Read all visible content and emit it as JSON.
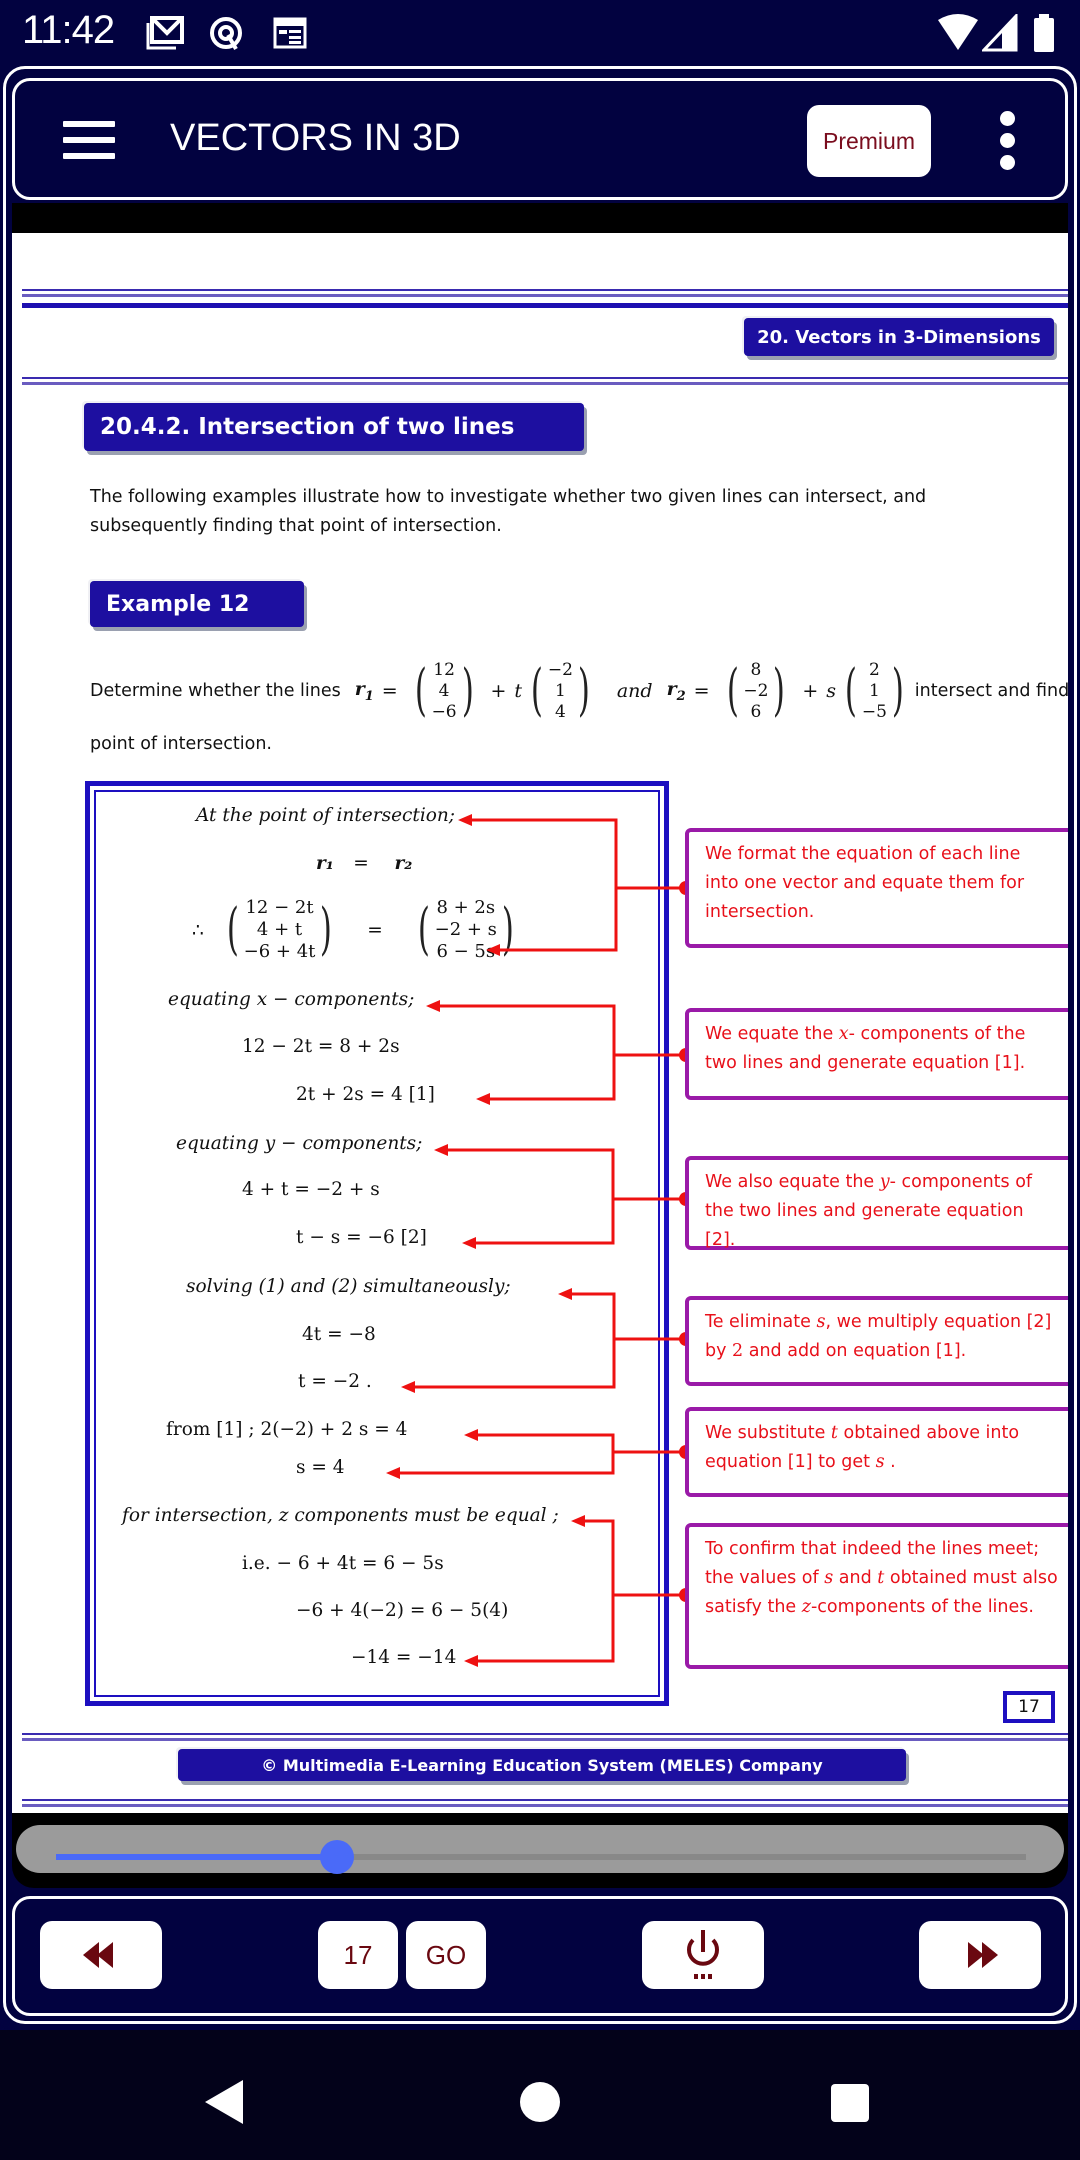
{
  "status_bar": {
    "time": "11:42",
    "left_icons": [
      "gmail-icon",
      "app-q-icon",
      "calendar-icon"
    ],
    "right_icons": [
      "wifi-icon",
      "signal-icon",
      "battery-icon"
    ]
  },
  "app_bar": {
    "title": "VECTORS IN 3D",
    "premium_label": "Premium",
    "menu_icon": "hamburger-menu-icon",
    "overflow_icon": "kebab-menu-icon"
  },
  "document": {
    "chapter_label": "20. Vectors in 3-Dimensions",
    "section_title": "20.4.2. Intersection of two lines",
    "intro": "The following examples illustrate how to investigate whether two given lines can intersect, and subsequently finding that point of intersection.",
    "example_label": "Example 12",
    "question": {
      "lead": "Determine whether the lines",
      "r1_label": "r",
      "r1_sub": "1",
      "eq": "=",
      "r1_point": [
        "12",
        "4",
        "−6"
      ],
      "plus": "+",
      "t": "t",
      "r1_dir": [
        "−2",
        "1",
        "4"
      ],
      "and": "and",
      "r2_label": "r",
      "r2_sub": "2",
      "r2_point": [
        "8",
        "−2",
        "6"
      ],
      "s": "s",
      "r2_dir": [
        "2",
        "1",
        "−5"
      ],
      "tail": "intersect and find this",
      "tail2": "point of intersection."
    },
    "solution": {
      "l1": "At the point of intersection;",
      "l2_left": "r₁",
      "l2_eq": "=",
      "l2_right": "r₂",
      "therefore": "∴",
      "lhs_vec": [
        "12 − 2t",
        "4 + t",
        "−6 + 4t"
      ],
      "rhs_vec": [
        "8 + 2s",
        "−2 + s",
        "6 − 5s"
      ],
      "l3_eq": "=",
      "x_head": "equating  x − components;",
      "x_eq1": "12 − 2t    =   8 +  2s",
      "x_eq2": "2t + 2s  =  4      [1]",
      "y_head": "equating  y − components;",
      "y_eq1": "4 + t    = −2 +  s",
      "y_eq2": "t − s  =  −6      [2]",
      "solve_head": "solving  (1)  and   (2)  simultaneously;",
      "solve_eq1": "4t  =  −8",
      "solve_eq2": "t     =  −2 .",
      "from1": "from  [1] ;    2(−2) + 2 s     =   4",
      "s_val": "s    =    4",
      "z_head": "for intersection,  z  components must be equal ;",
      "z_eq1": "i.e.    − 6 + 4t    =    6 − 5s",
      "z_eq2": "−6 + 4(−2) = 6 − 5(4)",
      "z_eq3": "−14  =  −14"
    },
    "notes": [
      {
        "text": "We format the equation of each line into one vector and equate them for intersection."
      },
      {
        "pre": "We equate the ",
        "var": "x",
        "post": "- components of the two lines and generate equation [1]."
      },
      {
        "pre": "We also equate the ",
        "var": "y",
        "post": "- components of the two lines and generate equation [2]."
      },
      {
        "pre": "Te eliminate ",
        "var": "s",
        "mid": ", we multiply equation [2] by ",
        "var2": "2",
        "post": " and add on equation [1]."
      },
      {
        "pre": "We substitute ",
        "var": "t",
        "mid": " obtained above into equation [1] to get ",
        "var2": "s",
        "post": " ."
      },
      {
        "pre": "To confirm that indeed the lines meet; the values of ",
        "var": "s",
        "mid": " and ",
        "var2": "t",
        "mid2": " obtained must also satisfy the ",
        "var3": "z",
        "post": "-components of the lines."
      }
    ],
    "page_number": "17",
    "footer": "© Multimedia E-Learning Education System (MELES) Company"
  },
  "slider": {
    "progress_fraction": 0.29
  },
  "bottom_nav": {
    "prev_icon": "rewind-icon",
    "page_input_value": "17",
    "go_label": "GO",
    "power_icon": "power-icon",
    "next_icon": "fast-forward-icon"
  },
  "colors": {
    "app_bg": "#020240",
    "chip_blue": "#1d0fa0",
    "note_red": "#e8101a",
    "note_border": "#9a1aa8",
    "premium_text": "#7a0d1e",
    "slider_blue": "#4a6af8"
  }
}
